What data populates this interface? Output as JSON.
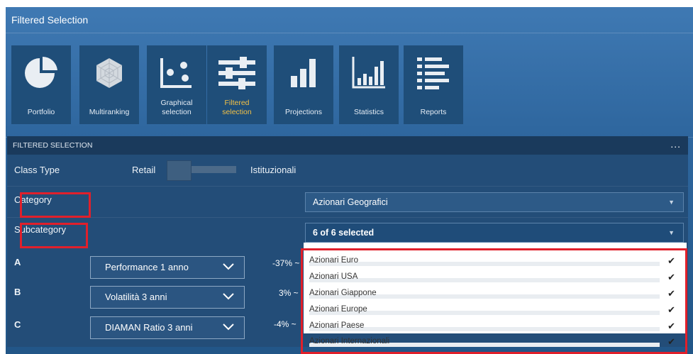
{
  "app": {
    "title": "Filtered Selection"
  },
  "tiles": [
    {
      "label": "Portfolio",
      "icon": "pie-chart-icon"
    },
    {
      "label": "Multiranking",
      "icon": "radar-chart-icon"
    },
    {
      "label": "Graphical\nselection",
      "icon": "scatter-plot-icon"
    },
    {
      "label": "Filtered\nselection",
      "icon": "sliders-icon",
      "active": true
    },
    {
      "label": "Projections",
      "icon": "bar-chart-icon"
    },
    {
      "label": "Statistics",
      "icon": "histogram-icon"
    },
    {
      "label": "Reports",
      "icon": "list-icon"
    }
  ],
  "panel": {
    "header": "FILTERED SELECTION",
    "menu": "...",
    "class_type": {
      "label": "Class Type",
      "left": "Retail",
      "right": "Istituzionali"
    },
    "category": {
      "label": "Category",
      "value": "Azionari Geografici"
    },
    "subcategory": {
      "label": "Subcategory",
      "value": "6 of 6 selected"
    },
    "metrics": [
      {
        "letter": "A",
        "name": "Performance 1 anno",
        "range": "-37% ~"
      },
      {
        "letter": "B",
        "name": "Volatilità 3 anni",
        "range": "3% ~"
      },
      {
        "letter": "C",
        "name": "DIAMAN Ratio 3 anni",
        "range": "-4% ~"
      }
    ]
  },
  "subcategory_options": [
    {
      "label": "Azionari Euro",
      "checked": true
    },
    {
      "label": "Azionari USA",
      "checked": true
    },
    {
      "label": "Azionari Giappone",
      "checked": true
    },
    {
      "label": "Azionari Europe",
      "checked": true
    },
    {
      "label": "Azionari Paese",
      "checked": true
    },
    {
      "label": "Azionari Internazionali",
      "checked": true
    }
  ],
  "colors": {
    "highlight": "#e0202b",
    "active_label": "#f3c146",
    "tile_bg": "#1f4e79"
  }
}
